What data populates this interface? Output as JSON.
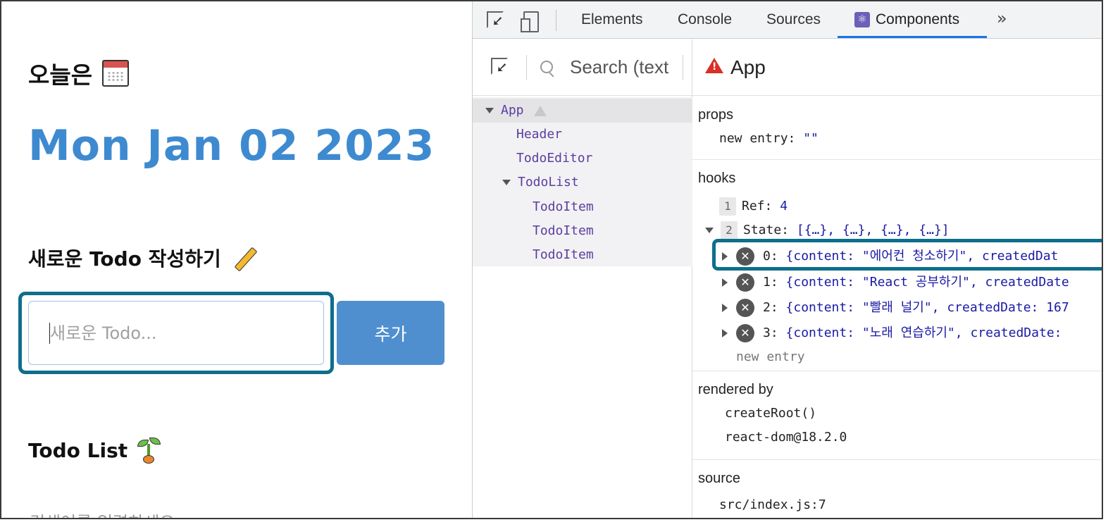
{
  "app": {
    "today_label": "오늘은",
    "date": "Mon Jan 02 2023",
    "editor_title": "새로운 Todo 작성하기",
    "input_placeholder": "새로운 Todo...",
    "add_button": "추가",
    "list_title": "Todo List",
    "search_placeholder": "검색어를 입력하세요",
    "icons": [
      "calendar-icon",
      "pencil-icon",
      "sprout-icon"
    ]
  },
  "devtools": {
    "tabs": [
      "Elements",
      "Console",
      "Sources",
      "Components"
    ],
    "active_tab": "Components",
    "more_tabs": "»",
    "tree_search_placeholder": "Search (text",
    "tree": [
      {
        "label": "App",
        "expanded": true,
        "warning": true
      },
      {
        "label": "Header"
      },
      {
        "label": "TodoEditor"
      },
      {
        "label": "TodoList",
        "expanded": true
      },
      {
        "label": "TodoItem"
      },
      {
        "label": "TodoItem"
      },
      {
        "label": "TodoItem"
      }
    ],
    "inspector": {
      "title": "App",
      "props_label": "props",
      "props": [
        {
          "key": "new entry:",
          "value": "\"\""
        }
      ],
      "hooks_label": "hooks",
      "hooks": [
        {
          "index": "1",
          "key": "Ref:",
          "value": "4"
        },
        {
          "index": "2",
          "key": "State:",
          "value": "[{…}, {…}, {…}, {…}]"
        }
      ],
      "state_items": [
        {
          "key": "0:",
          "value": "{content: \"에어컨 청소하기\", createdDat"
        },
        {
          "key": "1:",
          "value": "{content: \"React 공부하기\", createdDate"
        },
        {
          "key": "2:",
          "value": "{content: \"빨래 널기\", createdDate: 167"
        },
        {
          "key": "3:",
          "value": "{content: \"노래 연습하기\", createdDate:"
        }
      ],
      "new_entry": "new entry",
      "rendered_by_label": "rendered by",
      "rendered_by": [
        "createRoot()",
        "react-dom@18.2.0"
      ],
      "source_label": "source",
      "source": "src/index.js:7"
    }
  },
  "colors": {
    "date_blue": "#3e8ad0",
    "button_blue": "#4f8fcf",
    "highlight": "#0e6e8c",
    "tree_purple": "#5b3d9e",
    "value_blue": "#1a1aa6"
  }
}
